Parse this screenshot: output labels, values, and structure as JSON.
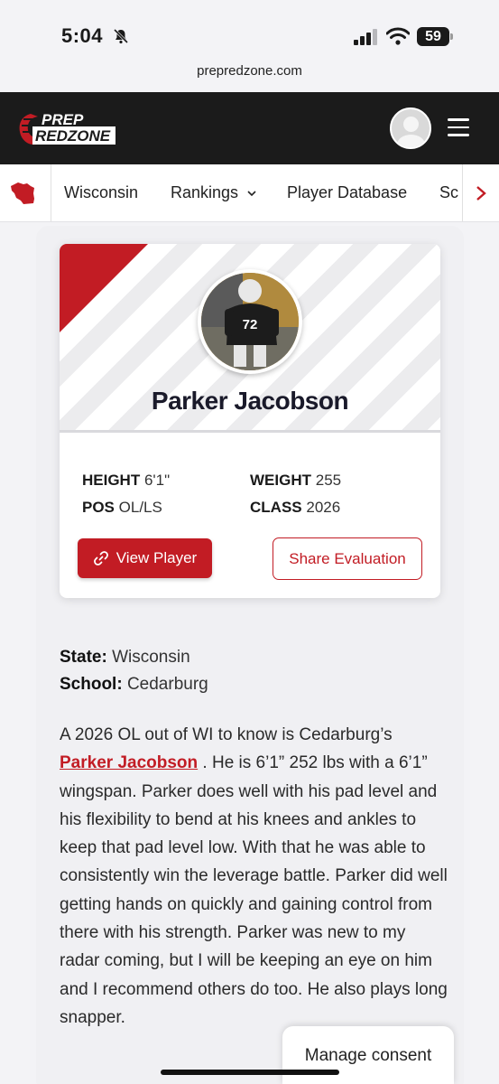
{
  "status_bar": {
    "time": "5:04",
    "battery": "59"
  },
  "browser": {
    "url": "prepredzone.com"
  },
  "header": {
    "logo_top": "PREP",
    "logo_bottom": "REDZONE"
  },
  "nav": {
    "items": [
      "Wisconsin",
      "Rankings",
      "Player Database",
      "Sc"
    ]
  },
  "player": {
    "name": "Parker Jacobson",
    "jersey": "72",
    "height_label": "HEIGHT",
    "height": "6'1\"",
    "weight_label": "WEIGHT",
    "weight": "255",
    "pos_label": "POS",
    "pos": "OL/LS",
    "class_label": "CLASS",
    "class": "2026",
    "view_button": "View Player",
    "share_button": "Share Evaluation"
  },
  "meta": {
    "state_label": "State:",
    "state": "Wisconsin",
    "school_label": "School:",
    "school": "Cedarburg"
  },
  "article": {
    "text_before": "A 2026 OL out of WI to know is Cedarburg’s",
    "link": "Parker Jacobson",
    "text_after": " . He is 6’1” 252 lbs with a 6’1” wingspan. Parker does well with his pad level and his flexibility to bend at his knees and ankles to keep that pad level low. With that he was able to consistently win the leverage battle. Parker did well getting hands on quickly and gaining control from there with his strength. Parker was new to my radar coming, but I will be keeping an eye on him and I recommend others do too. He also plays long snapper."
  },
  "consent": {
    "label": "Manage consent"
  },
  "colors": {
    "brand_red": "#c21c24",
    "header_bg": "#1b1b1b"
  }
}
